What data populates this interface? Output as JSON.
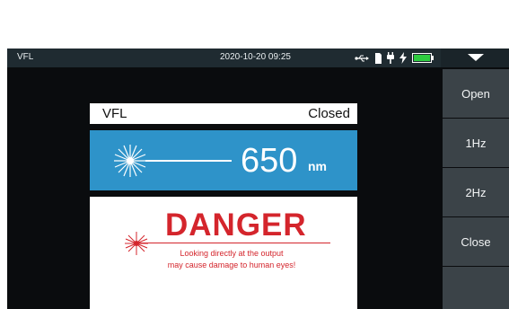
{
  "statusbar": {
    "app_name": "VFL",
    "datetime": "2020-10-20 09:25",
    "icons": [
      "usb-icon",
      "sd-card-icon",
      "plug-icon",
      "charging-icon",
      "battery-icon"
    ],
    "battery_color": "#2ecc40"
  },
  "panel": {
    "title": "VFL",
    "status": "Closed"
  },
  "wavelength": {
    "value": "650",
    "unit": "nm",
    "icon": "laser-starburst-icon"
  },
  "warning": {
    "title": "DANGER",
    "line1": "Looking directly at the output",
    "line2": "may cause damage to human eyes!",
    "icon": "laser-starburst-icon"
  },
  "sidebar": {
    "buttons": [
      {
        "label": "Open"
      },
      {
        "label": "1Hz"
      },
      {
        "label": "2Hz"
      },
      {
        "label": "Close"
      },
      {
        "label": ""
      }
    ]
  },
  "colors": {
    "accent_blue": "#2e93c9",
    "danger_red": "#d4252c",
    "button_gray": "#3b4348"
  }
}
